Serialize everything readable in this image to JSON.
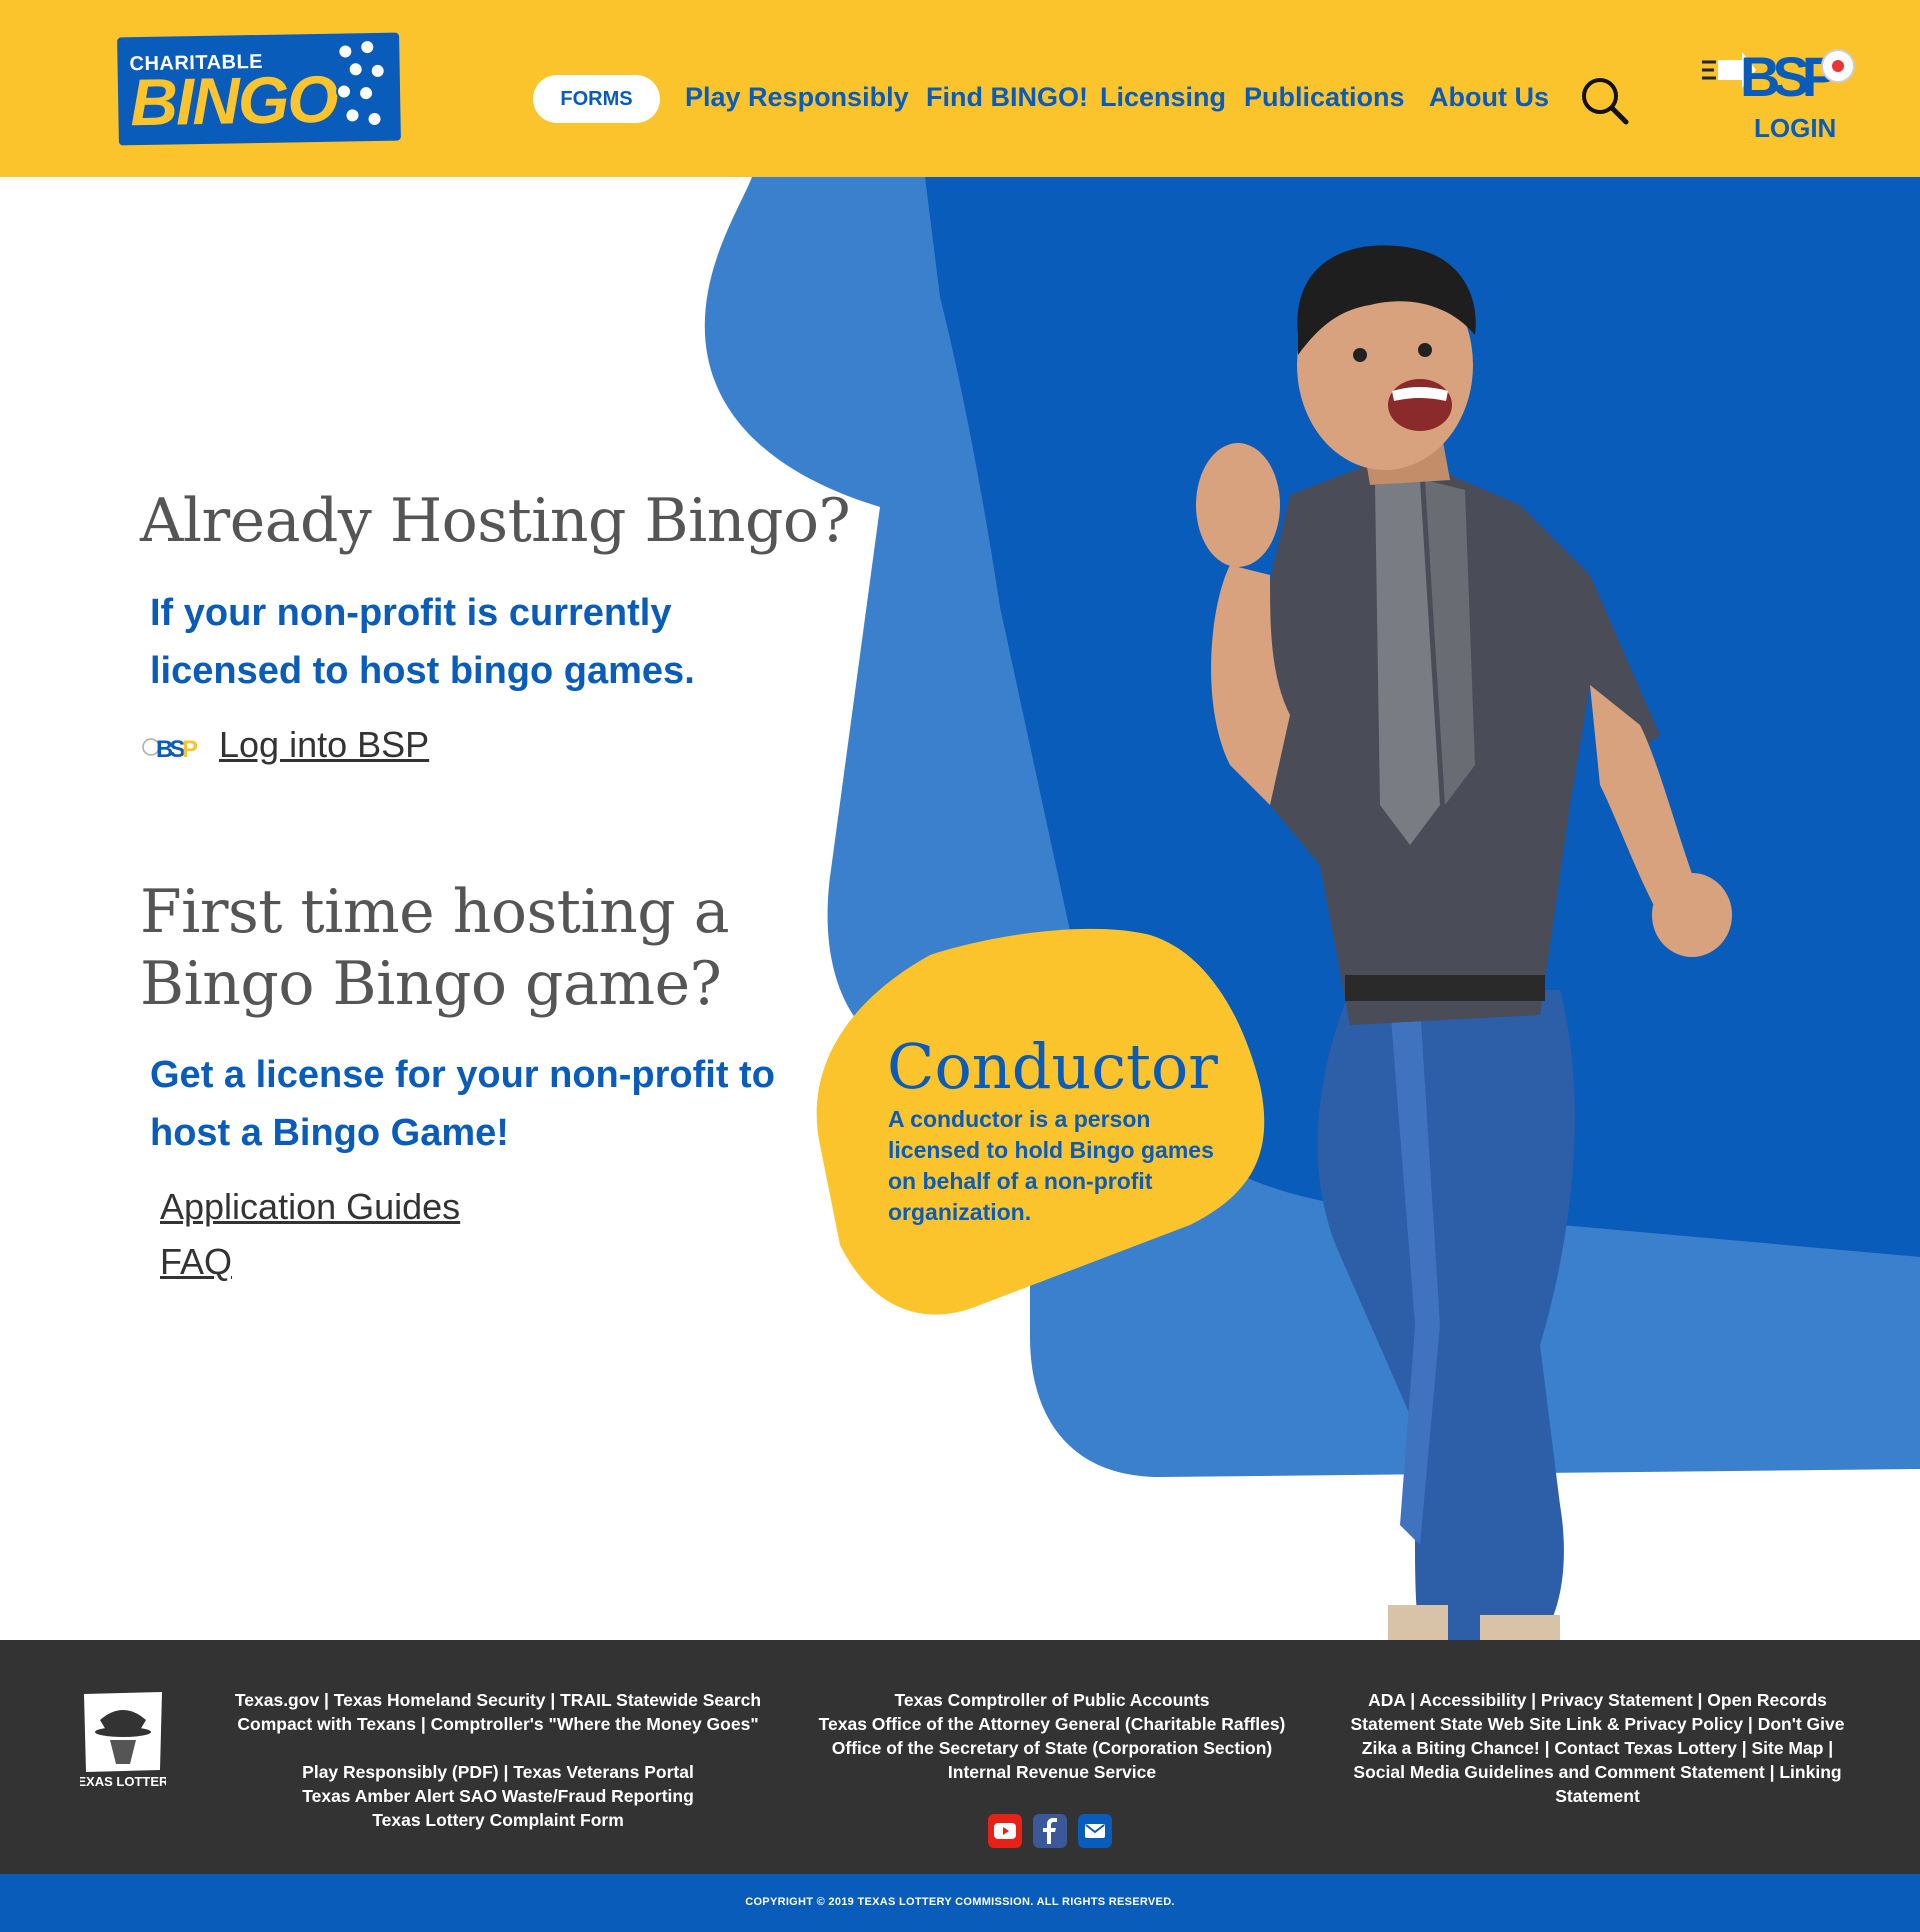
{
  "header": {
    "logo_top": "CHARITABLE",
    "logo_main": "BINGO",
    "forms_label": "FORMS",
    "nav": [
      {
        "label": "Play Responsibly"
      },
      {
        "label": "Find BINGO!"
      },
      {
        "label": "Licensing"
      },
      {
        "label": "Publications"
      },
      {
        "label": "About Us"
      }
    ],
    "search_icon": "search-icon",
    "login_logo_text": "BSP",
    "login_label": "LOGIN"
  },
  "main": {
    "section1": {
      "heading": "Already Hosting Bingo?",
      "subtext": "If your non-profit is currently licensed to host bingo games.",
      "bsp_link": "Log into BSP"
    },
    "section2": {
      "heading": "First time hosting a Bingo Bingo game?",
      "subtext": "Get a license for your non-profit to host a Bingo Game!",
      "links": [
        {
          "label": "Application Guides"
        },
        {
          "label": "FAQ"
        }
      ]
    },
    "callout": {
      "title": "Conductor",
      "text": "A conductor is a person licensed to hold Bingo games on behalf of a non-profit organization."
    }
  },
  "footer": {
    "logo_text": "TEXAS LOTTERY",
    "col1": {
      "line1": "Texas.gov | Texas Homeland Security | TRAIL Statewide Search",
      "line2": "Compact with Texans | Comptroller's \"Where the Money Goes\"",
      "line3": "Play Responsibly (PDF) | Texas Veterans Portal",
      "line4": "Texas Amber Alert SAO Waste/Fraud Reporting",
      "line5": "Texas Lottery Complaint Form"
    },
    "col2": {
      "line1": "Texas Comptroller of Public Accounts",
      "line2": "Texas Office of the Attorney General (Charitable Raffles)",
      "line3": "Office of the Secretary of State (Corporation Section)",
      "line4": "Internal Revenue Service"
    },
    "col3": {
      "line1": "ADA | Accessibility | Privacy Statement | Open Records",
      "line2": "Statement State Web Site Link & Privacy Policy | Don't Give",
      "line3": "Zika a Biting Chance! | Contact Texas Lottery | Site Map |",
      "line4": "Social Media Guidelines and Comment Statement | Linking",
      "line5": "Statement"
    },
    "social": [
      "youtube-icon",
      "facebook-icon",
      "email-icon"
    ],
    "copyright": "COPYRIGHT © 2019 TEXAS LOTTERY COMMISSION. ALL RIGHTS RESERVED."
  },
  "colors": {
    "brand_yellow": "#fcc42c",
    "brand_blue": "#0a5cba",
    "hero_light_blue": "#3a80cc",
    "footer_dark": "#333333",
    "heading_gray": "#555555"
  }
}
